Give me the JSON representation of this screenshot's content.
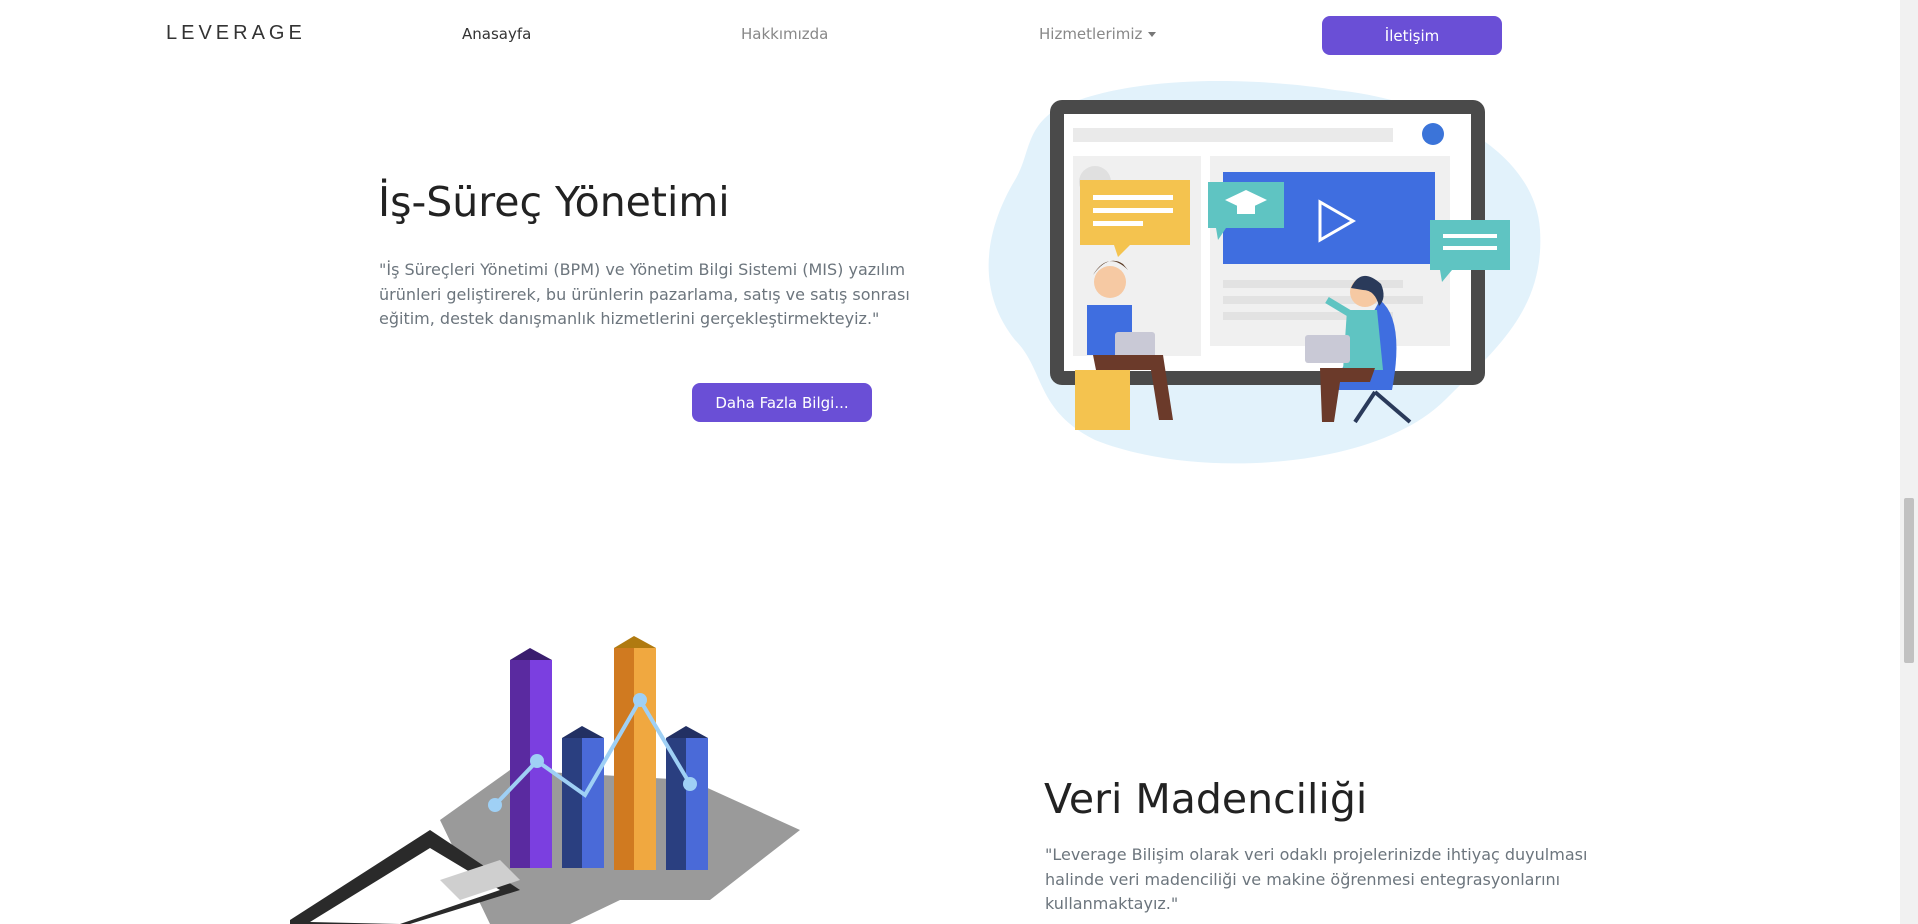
{
  "brand": "LEVERAGE",
  "nav": {
    "home": "Anasayfa",
    "about": "Hakkımızda",
    "services": "Hizmetlerimiz",
    "contact": "İletişim"
  },
  "section1": {
    "title": "İş-Süreç Yönetimi",
    "description": "\"İş Süreçleri Yönetimi (BPM) ve Yönetim Bilgi Sistemi (MIS) yazılım ürünleri geliştirerek, bu ürünlerin pazarlama, satış ve satış sonrası eğitim, destek danışmanlık hizmetlerini gerçekleştirmekteyiz.\"",
    "button": "Daha Fazla Bilgi..."
  },
  "section2": {
    "title": "Veri Madenciliği",
    "description": "\"Leverage Bilişim olarak veri odaklı projelerinizde ihtiyaç duyulması halinde veri madenciliği ve makine öğrenmesi entegrasyonlarını kullanmaktayız.\""
  },
  "colors": {
    "accent": "#6a4fd6",
    "text_muted": "#6c757d"
  }
}
